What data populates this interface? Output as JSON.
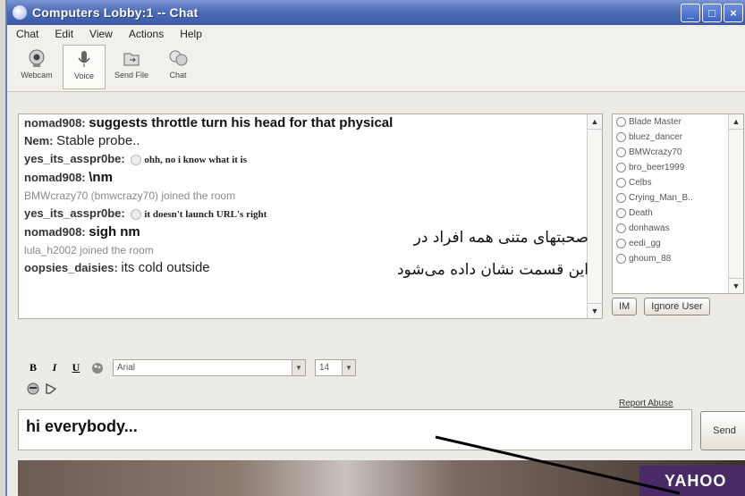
{
  "window": {
    "title": "Computers Lobby:1 -- Chat"
  },
  "menu": [
    "Chat",
    "Edit",
    "View",
    "Actions",
    "Help"
  ],
  "toolbar": [
    {
      "label": "Webcam",
      "icon": "webcam-icon"
    },
    {
      "label": "Voice",
      "icon": "microphone-icon"
    },
    {
      "label": "Send File",
      "icon": "send-file-icon"
    },
    {
      "label": "Chat",
      "icon": "chat-icon"
    }
  ],
  "messages": [
    {
      "nick": "nomad908:",
      "text": "suggests throttle turn his head for that physical"
    },
    {
      "nick": "Nem:",
      "text": "Stable probe.."
    },
    {
      "nick": "yes_its_asspr0be:",
      "text": "ohh, no i know what it is"
    },
    {
      "nick": "nomad908:",
      "text": "\\nm"
    },
    {
      "system": "BMWcrazy70 (bmwcrazy70) joined the room"
    },
    {
      "nick": "yes_its_asspr0be:",
      "text": "it doesn't launch URL's right"
    },
    {
      "nick": "nomad908:",
      "text": "sigh nm"
    },
    {
      "system": "lula_h2002 joined the room"
    },
    {
      "nick": "oopsies_daisies:",
      "text": "its cold outside"
    }
  ],
  "annotation": {
    "line1": "صحبتهای متنی همه افراد در",
    "line2": "این قسمت نشان داده می‌شود"
  },
  "users": [
    "Blade Master",
    "bluez_dancer",
    "BMWcrazy70",
    "bro_beer1999",
    "Celbs",
    "Crying_Man_B..",
    "Death",
    "donhawas",
    "eedi_gg",
    "ghoum_88"
  ],
  "user_buttons": {
    "im": "IM",
    "ignore": "Ignore User"
  },
  "format": {
    "bold": "B",
    "italic": "I",
    "underline": "U",
    "font": "Arial",
    "size": "14"
  },
  "report_abuse": "Report Abuse",
  "input": {
    "value": "hi everybody..."
  },
  "send_label": "Send",
  "banner": {
    "logo": "YAHOO"
  }
}
